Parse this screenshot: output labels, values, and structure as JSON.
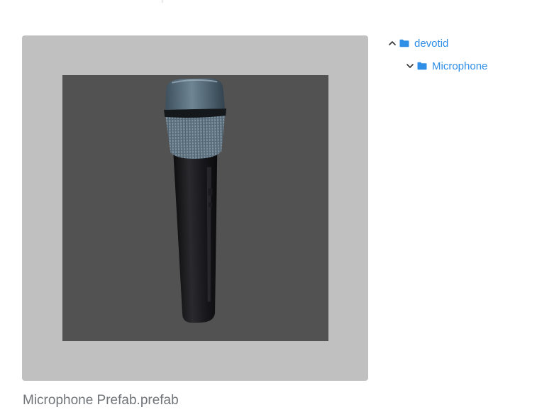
{
  "preview": {
    "file_name": "Microphone Prefab.prefab",
    "model_icon": "microphone-model-icon"
  },
  "tree": {
    "items": [
      {
        "label": "devotid",
        "state": "expanded",
        "chevron_icon": "chevron-up-icon",
        "icon": "folder-icon"
      },
      {
        "label": "Microphone",
        "state": "expanded",
        "chevron_icon": "chevron-down-icon",
        "icon": "folder-icon"
      }
    ]
  },
  "colors": {
    "link": "#2f8fe6",
    "panel_background": "#c0c0c0",
    "viewport_background": "#525252",
    "file_name_text": "#707478"
  }
}
